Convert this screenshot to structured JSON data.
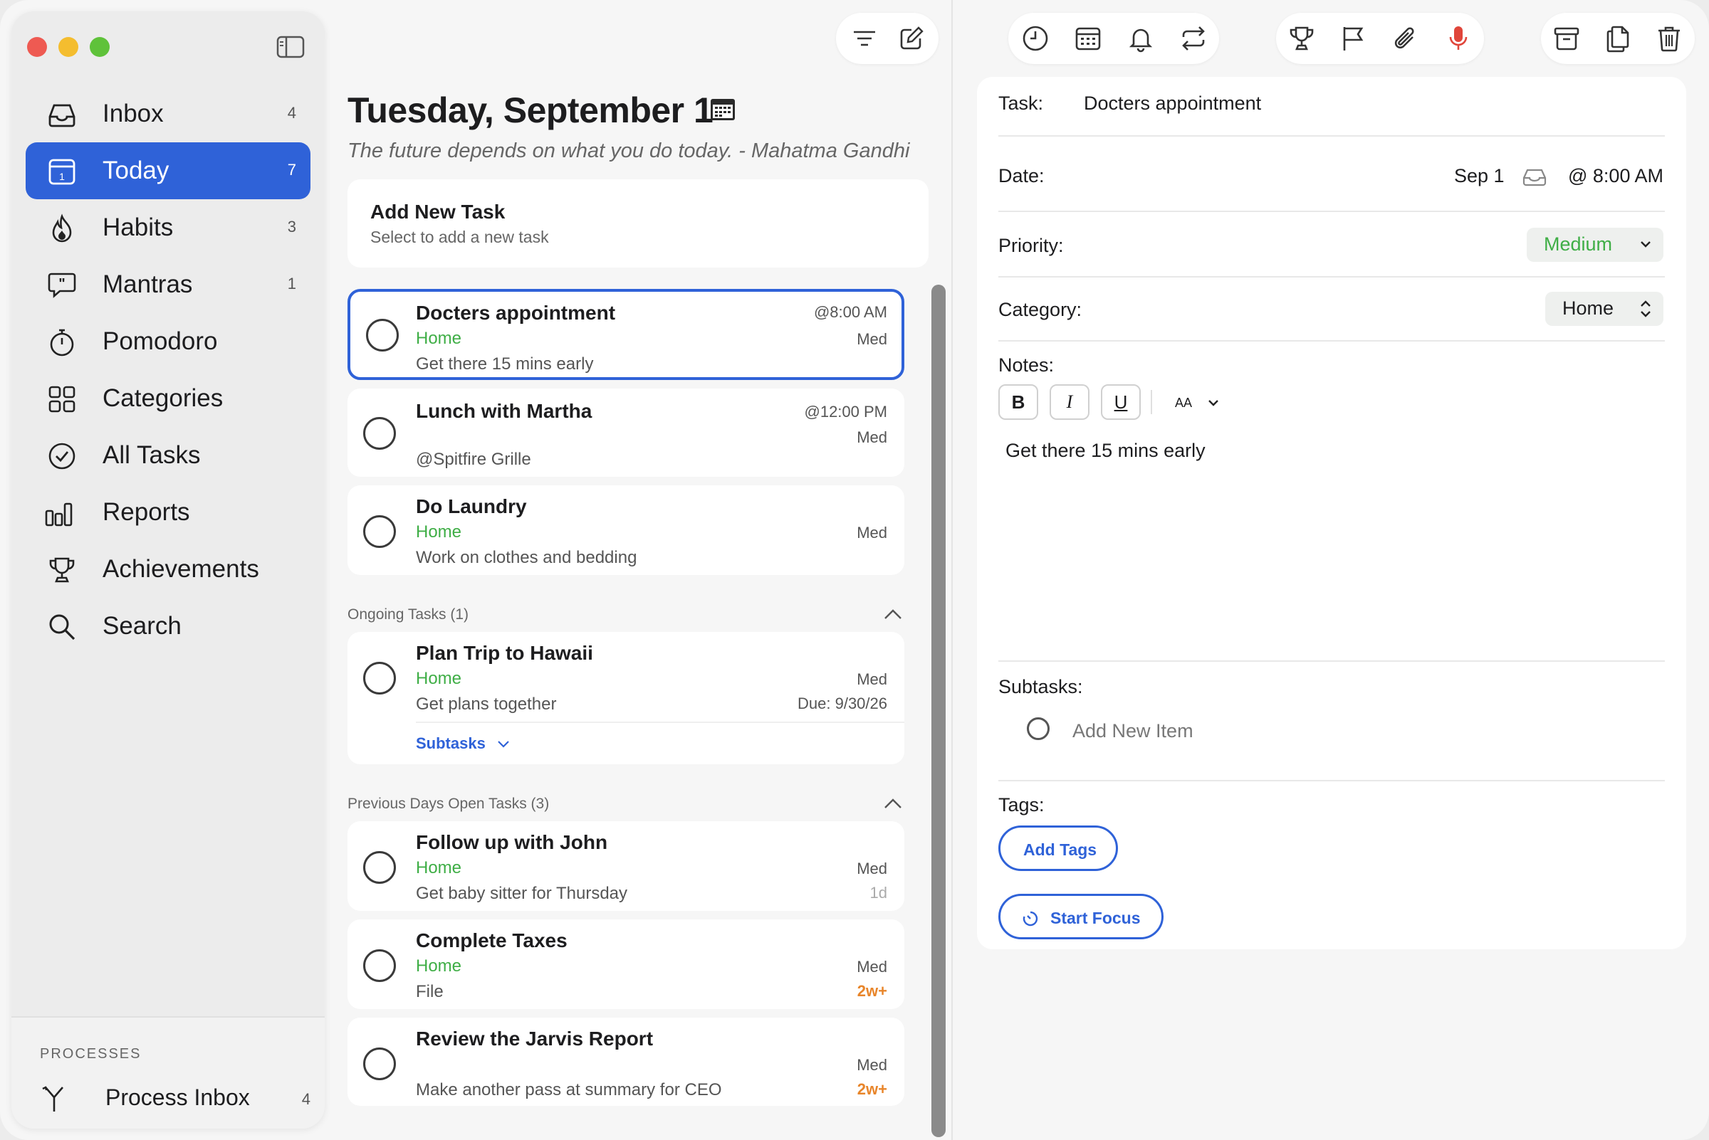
{
  "sidebar": {
    "items": [
      {
        "label": "Inbox",
        "count": "4",
        "icon": "inbox-icon"
      },
      {
        "label": "Today",
        "count": "7",
        "icon": "calendar-today-icon"
      },
      {
        "label": "Habits",
        "count": "3",
        "icon": "flame-icon"
      },
      {
        "label": "Mantras",
        "count": "1",
        "icon": "quote-bubble-icon"
      },
      {
        "label": "Pomodoro",
        "count": "",
        "icon": "stopwatch-icon"
      },
      {
        "label": "Categories",
        "count": "",
        "icon": "grid-icon"
      },
      {
        "label": "All Tasks",
        "count": "",
        "icon": "check-circle-icon"
      },
      {
        "label": "Reports",
        "count": "",
        "icon": "bar-chart-icon"
      },
      {
        "label": "Achievements",
        "count": "",
        "icon": "trophy-icon"
      },
      {
        "label": "Search",
        "count": "",
        "icon": "search-icon"
      }
    ],
    "processes_title": "PROCESSES",
    "process_inbox": {
      "label": "Process Inbox",
      "count": "4"
    }
  },
  "main": {
    "title": "Tuesday, September 1",
    "quote": "The future depends on what you do today. - Mahatma Gandhi",
    "add_task": {
      "title": "Add New Task",
      "subtitle": "Select to add a new task"
    },
    "today_tasks": [
      {
        "title": "Docters appointment",
        "category": "Home",
        "note": "Get there 15 mins early",
        "time": "@8:00 AM",
        "priority": "Med"
      },
      {
        "title": "Lunch with Martha",
        "category": "",
        "note": "@Spitfire Grille",
        "time": "@12:00 PM",
        "priority": "Med"
      },
      {
        "title": "Do Laundry",
        "category": "Home",
        "note": "Work on clothes and bedding",
        "time": "",
        "priority": "Med"
      }
    ],
    "ongoing_label": "Ongoing Tasks (1)",
    "ongoing_tasks": [
      {
        "title": "Plan Trip to Hawaii",
        "category": "Home",
        "note": "Get plans together",
        "priority": "Med",
        "due": "Due: 9/30/26",
        "subtasks_label": "Subtasks"
      }
    ],
    "previous_label": "Previous Days Open Tasks (3)",
    "previous_tasks": [
      {
        "title": "Follow up with John",
        "category": "Home",
        "note": "Get baby sitter for Thursday",
        "priority": "Med",
        "age": "1d"
      },
      {
        "title": "Complete Taxes",
        "category": "Home",
        "note": "File",
        "priority": "Med",
        "age": "2w+"
      },
      {
        "title": "Review the Jarvis Report",
        "category": "",
        "note": "Make another pass at summary for CEO",
        "priority": "Med",
        "age": "2w+"
      }
    ]
  },
  "detail": {
    "task_label": "Task:",
    "task_value": "Docters appointment",
    "date_label": "Date:",
    "date_value": "Sep 1",
    "time_value": "@ 8:00 AM",
    "priority_label": "Priority:",
    "priority_value": "Medium",
    "category_label": "Category:",
    "category_value": "Home",
    "notes_label": "Notes:",
    "format_bold": "B",
    "format_italic": "I",
    "format_underline": "U",
    "format_size": "AA",
    "notes_text": "Get there 15 mins early",
    "subtasks_label": "Subtasks:",
    "subtask_placeholder": "Add New Item",
    "tags_label": "Tags:",
    "add_tags": "Add Tags",
    "start_focus": "Start Focus"
  },
  "colors": {
    "accent": "#2f62d8",
    "category_green": "#3fae46",
    "age_orange": "#e8852a",
    "mic_red": "#e0453a"
  }
}
